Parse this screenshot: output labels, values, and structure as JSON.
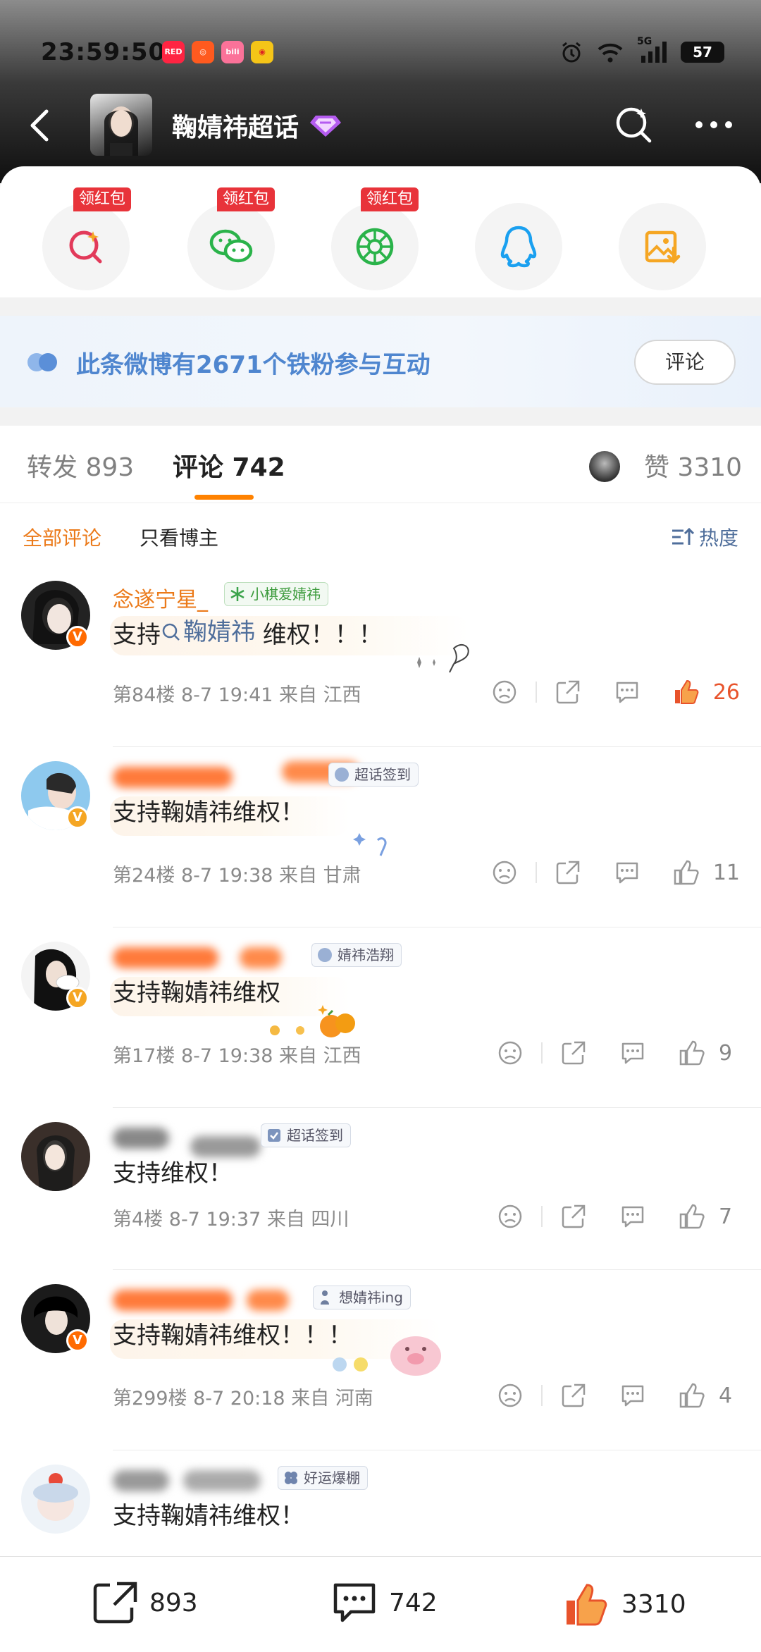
{
  "status_bar": {
    "time": "23:59:50",
    "network": "5G",
    "battery": "57",
    "app_icons": [
      "小红书",
      "app-icon",
      "bilibili",
      "weibo"
    ]
  },
  "nav": {
    "title": "鞠婧祎超话"
  },
  "share_row": {
    "badge": "领红包",
    "items": [
      "weibo-search-share",
      "wechat-share",
      "moments-share",
      "qq-share",
      "save-image"
    ]
  },
  "banner": {
    "text": "此条微博有2671个铁粉参与互动",
    "button": "评论"
  },
  "tabs": {
    "repost": "转发 893",
    "comment": "评论 742",
    "like": "赞 3310"
  },
  "filters": {
    "all": "全部评论",
    "owner_only": "只看博主",
    "sort": "热度"
  },
  "comments": [
    {
      "nick": "念遂宁星_",
      "tag": "小棋爱婧祎",
      "text_prefix": "支持",
      "text_link": "鞠婧祎",
      "text_suffix": " 维权！！！",
      "meta": "第84楼  8-7 19:41  来自 江西",
      "likes": "26"
    },
    {
      "tag": "超话签到",
      "text": "支持鞠婧祎维权！",
      "meta": "第24楼  8-7 19:38  来自 甘肃",
      "likes": "11"
    },
    {
      "tag": "婧祎浩翔",
      "text": "支持鞠婧祎维权",
      "meta": "第17楼  8-7 19:38  来自 江西",
      "likes": "9"
    },
    {
      "tag": "超话签到",
      "text": "支持维权！",
      "meta": "第4楼  8-7 19:37  来自 四川",
      "likes": "7"
    },
    {
      "tag": "想婧祎ing",
      "text": "支持鞠婧祎维权！！！",
      "meta": "第299楼  8-7 20:18  来自 河南",
      "likes": "4"
    },
    {
      "tag": "好运爆棚",
      "text": "支持鞠婧祎维权！"
    }
  ],
  "bottom_bar": {
    "repost": "893",
    "comment": "742",
    "like": "3310"
  },
  "colors": {
    "accent": "#ff8200",
    "link": "#4f86cf",
    "like_active": "#e8532b"
  }
}
